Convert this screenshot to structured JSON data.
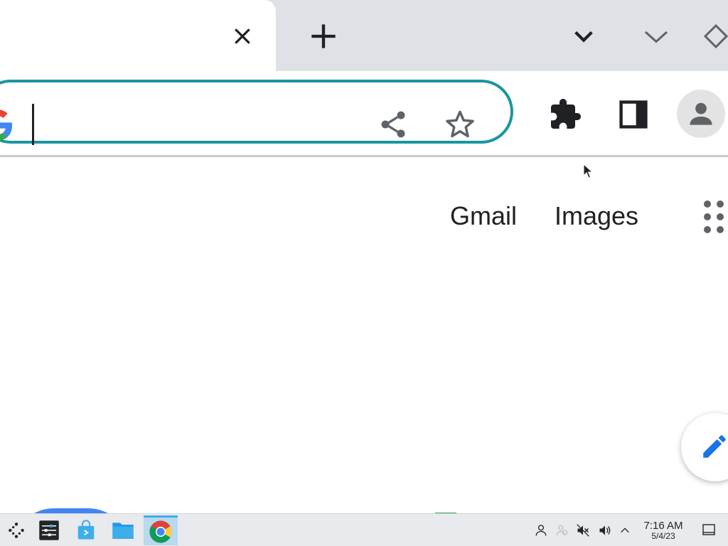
{
  "tabstrip": {
    "tab": {
      "close_icon": "close-icon"
    },
    "new_tab_icon": "plus-icon",
    "tab_search_icon": "chevron-down-icon",
    "window_controls": [
      "minimize-icon",
      "restore-icon"
    ]
  },
  "toolbar": {
    "omnibox": {
      "value": "",
      "placeholder": "",
      "logo_icon": "google-g-icon"
    },
    "share_icon": "share-icon",
    "bookmark_icon": "star-icon",
    "extensions_icon": "puzzle-icon",
    "side_panel_icon": "side-panel-icon",
    "profile_icon": "person-icon"
  },
  "page": {
    "header_links": {
      "gmail": "Gmail",
      "images": "Images"
    },
    "apps_icon": "apps-grid-icon",
    "edit_icon": "pencil-icon"
  },
  "taskbar": {
    "apps": [
      "launcher-icon",
      "settings-icon",
      "discover-store-icon",
      "file-manager-icon",
      "chrome-icon"
    ],
    "tray": [
      "user-icon",
      "users-icon",
      "mic-muted-icon",
      "volume-icon",
      "tray-expand-icon"
    ],
    "clock": {
      "time": "7:16 AM",
      "date": "5/4/23"
    },
    "show_desktop_icon": "show-desktop-icon"
  },
  "colors": {
    "tabstrip_bg": "#dee1e6",
    "omnibox_focus_ring": "#1a96a0",
    "taskbar_bg": "#e8eaed",
    "active_task_highlight": "#b8d9ee",
    "google_blue": "#4285f4",
    "google_red": "#ea4335",
    "google_yellow": "#fbbc05",
    "google_green": "#34a853"
  }
}
